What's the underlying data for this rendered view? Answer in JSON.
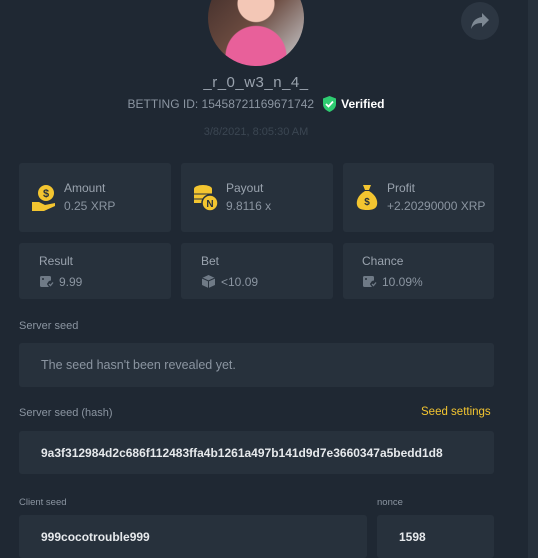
{
  "profile": {
    "username": "_r_0_w3_n_4_",
    "betting_id_label": "BETTING ID: 15458721169671742",
    "verified_label": "Verified",
    "date": "3/8/2021, 8:05:30 AM"
  },
  "stats": {
    "amount": {
      "label": "Amount",
      "value": "0.25 XRP"
    },
    "payout": {
      "label": "Payout",
      "value": "9.8116 x"
    },
    "profit": {
      "label": "Profit",
      "value": "+2.20290000 XRP"
    },
    "result": {
      "label": "Result",
      "value": "9.99"
    },
    "bet": {
      "label": "Bet",
      "value": "<10.09"
    },
    "chance": {
      "label": "Chance",
      "value": "10.09%"
    }
  },
  "seeds": {
    "server_seed_label": "Server seed",
    "server_seed_value": "The seed hasn't been revealed yet.",
    "server_hash_label": "Server seed (hash)",
    "seed_settings_label": "Seed settings",
    "server_hash_value": "9a3f312984d2c686f112483ffa4b1261a497b141d9d7e3660347a5bedd1d8",
    "client_seed_label": "Client seed",
    "client_seed_value": "999cocotrouble999",
    "nonce_label": "nonce",
    "nonce_value": "1598"
  },
  "colors": {
    "background": "#1f2833",
    "card": "#27313c",
    "accent_gold": "#f3c530",
    "verified_green": "#2ecc71"
  },
  "icons": [
    "share-icon",
    "verified-check-icon",
    "money-hand-icon",
    "coins-icon",
    "money-bag-icon",
    "dice-icon"
  ]
}
